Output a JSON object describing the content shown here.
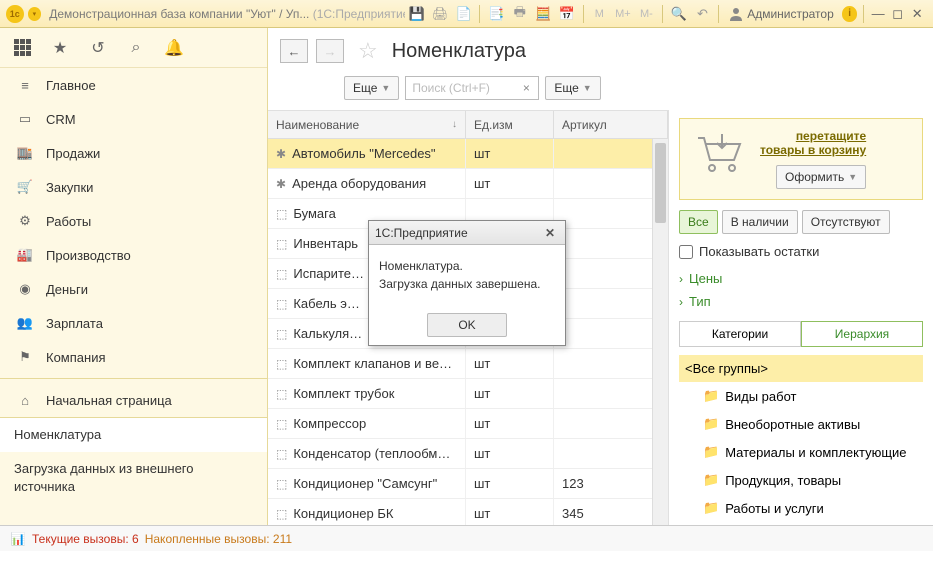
{
  "window": {
    "title": "Демонстрационная база компании \"Уют\" / Уп...",
    "title_suffix": " (1С:Предприятие)",
    "admin": "Администратор"
  },
  "sidebar": {
    "items": [
      {
        "label": "Главное"
      },
      {
        "label": "CRM"
      },
      {
        "label": "Продажи"
      },
      {
        "label": "Закупки"
      },
      {
        "label": "Работы"
      },
      {
        "label": "Производство"
      },
      {
        "label": "Деньги"
      },
      {
        "label": "Зарплата"
      },
      {
        "label": "Компания"
      }
    ],
    "home_label": "Начальная страница",
    "open_tabs": [
      {
        "label": "Номенклатура",
        "active": true
      },
      {
        "label": "Загрузка данных из внешнего источника",
        "active": false
      }
    ]
  },
  "page": {
    "title": "Номенклатура",
    "more_btn1": "Еще",
    "more_btn2": "Еще",
    "search_placeholder": "Поиск (Ctrl+F)"
  },
  "table": {
    "columns": {
      "name": "Наименование",
      "unit": "Ед.изм",
      "article": "Артикул"
    },
    "rows": [
      {
        "name": "Автомобиль \"Mercedes\"",
        "unit": "шт",
        "article": "",
        "selected": true,
        "icon": "wrench"
      },
      {
        "name": "Аренда оборудования",
        "unit": "шт",
        "article": "",
        "icon": "wrench"
      },
      {
        "name": "Бумага",
        "unit": "",
        "article": "",
        "icon": "cube"
      },
      {
        "name": "Инвентарь",
        "unit": "",
        "article": "",
        "icon": "cube"
      },
      {
        "name": "Испарите…",
        "unit": "",
        "article": "",
        "icon": "cube"
      },
      {
        "name": "Кабель э…",
        "unit": "",
        "article": "",
        "icon": "cube"
      },
      {
        "name": "Калькуля…",
        "unit": "",
        "article": "",
        "icon": "cube"
      },
      {
        "name": "Комплект клапанов и ве…",
        "unit": "шт",
        "article": "",
        "icon": "cube"
      },
      {
        "name": "Комплект трубок",
        "unit": "шт",
        "article": "",
        "icon": "cube"
      },
      {
        "name": "Компрессор",
        "unit": "шт",
        "article": "",
        "icon": "cube"
      },
      {
        "name": "Конденсатор (теплообм…",
        "unit": "шт",
        "article": "",
        "icon": "cube"
      },
      {
        "name": "Кондиционер \"Самсунг\"",
        "unit": "шт",
        "article": "123",
        "icon": "cube"
      },
      {
        "name": "Кондиционер БК",
        "unit": "шт",
        "article": "345",
        "icon": "cube"
      }
    ]
  },
  "cart": {
    "line1": "перетащите",
    "line2": "товары в корзину",
    "checkout": "Оформить"
  },
  "filters": {
    "all": "Все",
    "instock": "В наличии",
    "outofstock": "Отсутствуют",
    "show_remains": "Показывать остатки"
  },
  "expanders": {
    "prices": "Цены",
    "type": "Тип"
  },
  "tabs": {
    "categories": "Категории",
    "hierarchy": "Иерархия"
  },
  "tree": {
    "root": "<Все группы>",
    "items": [
      {
        "label": "Виды работ"
      },
      {
        "label": "Внеоборотные активы"
      },
      {
        "label": "Материалы и комплектующие"
      },
      {
        "label": "Продукция, товары"
      },
      {
        "label": "Работы и услуги"
      }
    ]
  },
  "modal": {
    "title": "1С:Предприятие",
    "line1": "Номенклатура.",
    "line2": "Загрузка данных завершена.",
    "ok": "OK"
  },
  "status": {
    "current": "Текущие вызовы:",
    "current_n": "6",
    "accum": "Накопленные вызовы:",
    "accum_n": "211"
  }
}
